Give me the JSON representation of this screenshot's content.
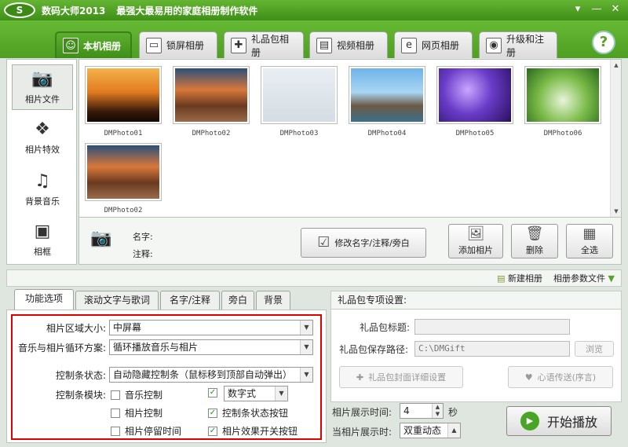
{
  "app": {
    "logo_text": "S",
    "name": "数码大师2013",
    "slogan": "最强大最易用的家庭相册制作软件",
    "window_buttons": [
      "▾",
      "—",
      "✕"
    ]
  },
  "main_tabs": [
    {
      "label": "本机相册",
      "icon": "portrait-icon",
      "glyph": "☺"
    },
    {
      "label": "锁屏相册",
      "icon": "monitor-icon",
      "glyph": "▭"
    },
    {
      "label": "礼品包相册",
      "icon": "gift-icon",
      "glyph": "✚"
    },
    {
      "label": "视频相册",
      "icon": "film-icon",
      "glyph": "▤"
    },
    {
      "label": "网页相册",
      "icon": "browser-e-icon",
      "glyph": "e"
    },
    {
      "label": "升级和注册",
      "icon": "globe-icon",
      "glyph": "◉"
    }
  ],
  "help_label": "?",
  "sidebar": [
    {
      "label": "相片文件",
      "icon": "camera-icon",
      "glyph": "📷"
    },
    {
      "label": "相片特效",
      "icon": "sparkle-icon",
      "glyph": "❖"
    },
    {
      "label": "背景音乐",
      "icon": "music-note-icon",
      "glyph": "♫"
    },
    {
      "label": "相框",
      "icon": "picture-frame-icon",
      "glyph": "▣"
    }
  ],
  "photos": [
    {
      "name": "DMPhoto01",
      "bg": "linear-gradient(180deg,#f6b24a 0%,#e07a20 45%,#3a1c0c 80%,#110800 100%)"
    },
    {
      "name": "DMPhoto02",
      "bg": "linear-gradient(180deg,#2b4f7a 0%,#d9783a 40%,#6a3a20 70%,#9a6a4a 100%)"
    },
    {
      "name": "DMPhoto03",
      "bg": "linear-gradient(180deg,#e9eef2 0%,#d4dde4 100%)"
    },
    {
      "name": "DMPhoto04",
      "bg": "linear-gradient(180deg,#6fb3e8 0%,#a9d5f2 45%,#6b5a46 70%,#3d6f8a 100%)"
    },
    {
      "name": "DMPhoto05",
      "bg": "radial-gradient(circle at 40% 40%,#c9a6ff 0%,#6a3cc8 45%,#281060 100%)"
    },
    {
      "name": "DMPhoto06",
      "bg": "radial-gradient(circle at 50% 60%,#e8f4d8 0%,#7cbc4a 50%,#2a6a1c 100%)"
    },
    {
      "name": "DMPhoto02",
      "bg": "linear-gradient(180deg,#2b4f7a 0%,#d9783a 40%,#6a3a20 70%,#9a6a4a 100%)"
    }
  ],
  "info": {
    "name_label": "名字:",
    "note_label": "注释:",
    "edit_button": "修改名字/注释/旁白",
    "add_button": "添加相片",
    "delete_button": "删除",
    "select_all_button": "全选"
  },
  "midbar": {
    "new_album": "新建相册",
    "album_params": "相册参数文件"
  },
  "sub_tabs": [
    "功能选项",
    "滚动文字与歌词",
    "名字/注释",
    "旁白",
    "背景"
  ],
  "options": {
    "region_label": "相片区域大小:",
    "region_value": "中屏幕",
    "loop_label": "音乐与相片循环方案:",
    "loop_value": "循环播放音乐与相片",
    "control_label": "控制条状态:",
    "control_value": "自动隐藏控制条（鼠标移到顶部自动弹出）",
    "module_label": "控制条模块:",
    "checks": [
      {
        "label": "音乐控制",
        "checked": false
      },
      {
        "label": "相片控制",
        "checked": false
      },
      {
        "label": "相片停留时间",
        "checked": false
      },
      {
        "label": "",
        "checked": true
      },
      {
        "label": "控制条状态按钮",
        "checked": true
      },
      {
        "label": "相片效果开关按钮",
        "checked": true
      }
    ],
    "number_style_value": "数字式"
  },
  "gift": {
    "header": "礼品包专项设置:",
    "title_label": "礼品包标题:",
    "title_value": "",
    "path_label": "礼品包保存路径:",
    "path_value": "C:\\DMGift",
    "browse": "浏览",
    "cover_button": "礼品包封面详细设置",
    "heart_button": "心语传送(序言)"
  },
  "playback": {
    "time_label": "相片展示时间:",
    "time_value": "4",
    "time_unit": "秒",
    "mode_label": "当相片展示时:",
    "mode_value": "双重动态",
    "play_button": "开始播放"
  }
}
